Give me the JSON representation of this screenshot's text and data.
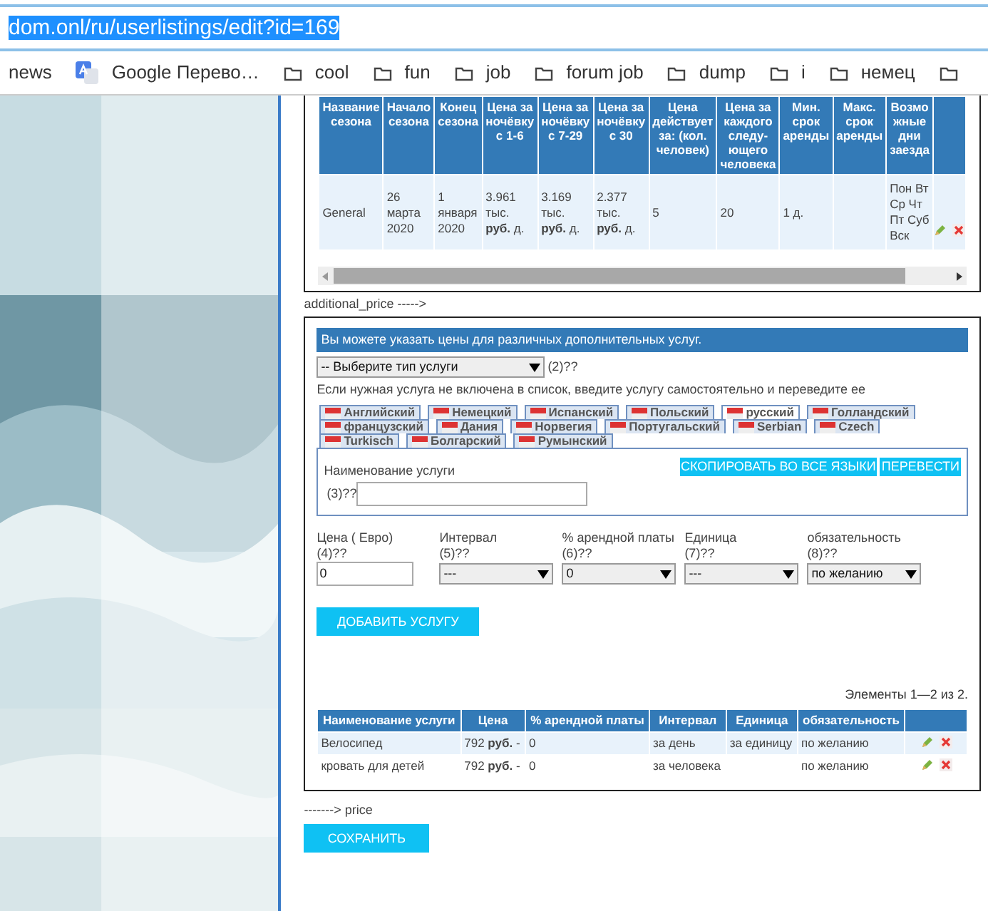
{
  "address_bar": {
    "url": "dom.onl/ru/userlistings/edit?id=169",
    "selected": true
  },
  "bookmarks": [
    {
      "kind": "plain",
      "label": "news"
    },
    {
      "kind": "translate",
      "label": "Google Перево…"
    },
    {
      "kind": "folder",
      "label": "cool"
    },
    {
      "kind": "folder",
      "label": "fun"
    },
    {
      "kind": "folder",
      "label": "job"
    },
    {
      "kind": "folder",
      "label": "forum job"
    },
    {
      "kind": "folder",
      "label": "dump"
    },
    {
      "kind": "folder",
      "label": "i"
    },
    {
      "kind": "folder",
      "label": "немец"
    },
    {
      "kind": "folder_icon_only"
    }
  ],
  "seasons_table": {
    "columns": [
      "Название сезона",
      "Начало сезона",
      "Конец сезона",
      "Цена за ночёвку с 1-6",
      "Цена за ночёвку с 7-29",
      "Цена за ночёвку с 30",
      "Цена действует за: (кол. человек)",
      "Цена за каждого следу-ющего человека",
      "Мин. срок аренды",
      "Макс. срок аренды",
      "Возмо жные дни заезда"
    ],
    "rows": [
      {
        "cells": [
          "General",
          "26 марта 2020",
          "1 января 2020",
          "3.961 тыс. **руб.** д.",
          "3.169 тыс. **руб.** д.",
          "2.377 тыс. **руб.** д.",
          "5",
          "20",
          "1 д.",
          null,
          "Пон Вт Ср Чт Пт Суб Вск"
        ]
      }
    ]
  },
  "additional_price_label": "additional_price ----->",
  "services": {
    "banner": "Вы можете указать цены для различных дополнительных услуг.",
    "type_select": {
      "value": "-- Выберите тип услуги",
      "hint": "(2)??"
    },
    "note": "Если нужная услуга не включена в список, введите услугу самостоятельно и переведите ее",
    "language_tabs": [
      {
        "label": "Английский",
        "selected": false
      },
      {
        "label": "Немецкий",
        "selected": false
      },
      {
        "label": "Испанский",
        "selected": false
      },
      {
        "label": "Польский",
        "selected": false
      },
      {
        "label": "русский",
        "selected": true
      },
      {
        "label": "Голландский",
        "selected": false
      },
      {
        "label": "французский",
        "selected": false
      },
      {
        "label": "Дания",
        "selected": false
      },
      {
        "label": "Норвегия",
        "selected": false
      },
      {
        "label": "Португальский",
        "selected": false
      },
      {
        "label": "Serbian",
        "selected": false
      },
      {
        "label": "Czech",
        "selected": false
      },
      {
        "label": "Turkisch",
        "selected": false
      },
      {
        "label": "Болгарский",
        "selected": false
      },
      {
        "label": "Румынский",
        "selected": false
      }
    ],
    "name_label": "Наименование услуги",
    "name_hint": "(3)??",
    "copy_button": "СКОПИРОВАТЬ ВО ВСЕ ЯЗЫКИ",
    "translate_button": "ПЕРЕВЕСТИ",
    "fields": [
      {
        "kind": "input",
        "label": "Цена ( Евро)",
        "hint": "(4)??",
        "value": "0"
      },
      {
        "kind": "select",
        "label": "Интервал",
        "hint": "(5)??",
        "value": "---"
      },
      {
        "kind": "select",
        "label": "% арендной платы",
        "hint": "(6)??",
        "value": "0"
      },
      {
        "kind": "select",
        "label": "Единица",
        "hint": "(7)??",
        "value": "---"
      },
      {
        "kind": "select",
        "label": "обязательность",
        "hint": "(8)??",
        "value": "по желанию"
      }
    ],
    "add_button": "ДОБАВИТЬ УСЛУГУ",
    "summary": "Элементы 1—2 из 2.",
    "table": {
      "columns": [
        "Наименование услуги",
        "Цена",
        "% арендной платы",
        "Интервал",
        "Единица",
        "обязательность"
      ],
      "rows": [
        {
          "cells": [
            "Велосипед",
            "792 **руб.** -",
            "0",
            "за день",
            "за единицу",
            "по желанию"
          ]
        },
        {
          "cells": [
            "кровать для детей",
            "792 **руб.** -",
            "0",
            "за человека",
            null,
            "по желанию"
          ]
        }
      ]
    }
  },
  "price_label": "-------> price",
  "save_button": "СОХРАНИТЬ"
}
